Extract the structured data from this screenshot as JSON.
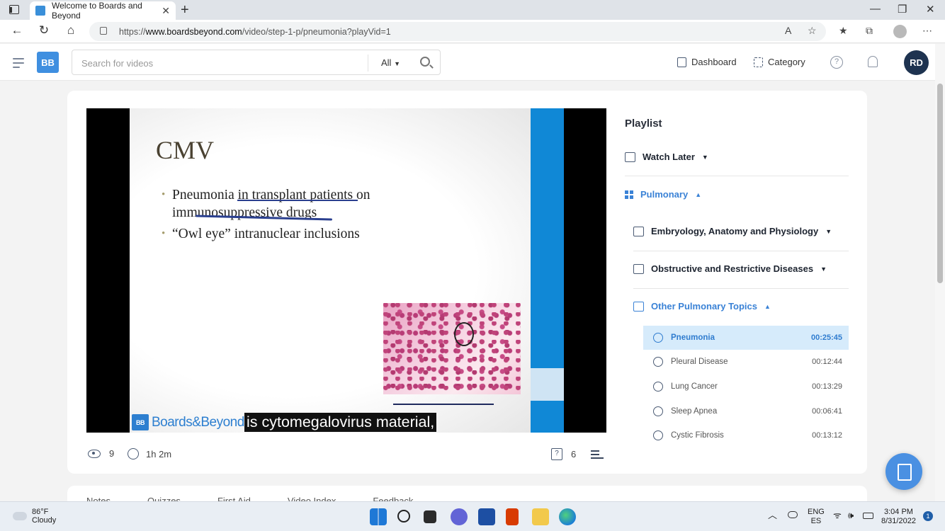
{
  "browser": {
    "tab_title": "Welcome to Boards and Beyond",
    "url_prefix": "https://",
    "url_host": "www.boardsbeyond.com",
    "url_path": "/video/step-1-p/pneumonia?playVid=1"
  },
  "header": {
    "logo_text": "BB",
    "search_placeholder": "Search for videos",
    "filter_label": "All",
    "dashboard_label": "Dashboard",
    "category_label": "Category",
    "help_label": "?",
    "avatar_initials": "RD"
  },
  "video": {
    "slide_title": "CMV",
    "bullet_1": "Pneumonia in transplant patients on immunosuppressive drugs",
    "bullet_2": "“Owl eye” intranuclear inclusions",
    "watermark": "Boards&Beyond",
    "watermark_logo": "BB",
    "caption": "is cytomegalovirus material,",
    "views": "9",
    "duration": "1h 2m",
    "questions": "6"
  },
  "playlist": {
    "title": "Playlist",
    "watch_later": "Watch Later",
    "pulmonary": "Pulmonary",
    "sections": [
      "Embryology, Anatomy and Physiology",
      "Obstructive and Restrictive Diseases",
      "Other Pulmonary Topics"
    ],
    "videos": [
      {
        "name": "Pneumonia",
        "time": "00:25:45"
      },
      {
        "name": "Pleural Disease",
        "time": "00:12:44"
      },
      {
        "name": "Lung Cancer",
        "time": "00:13:29"
      },
      {
        "name": "Sleep Apnea",
        "time": "00:06:41"
      },
      {
        "name": "Cystic Fibrosis",
        "time": "00:13:12"
      }
    ]
  },
  "lower_tabs": [
    "Notes",
    "Quizzes",
    "First Aid",
    "Video Index",
    "Feedback"
  ],
  "taskbar": {
    "temp": "86°F",
    "condition": "Cloudy",
    "lang_1": "ENG",
    "lang_2": "ES",
    "time": "3:04 PM",
    "date": "8/31/2022",
    "notifications": "1"
  }
}
